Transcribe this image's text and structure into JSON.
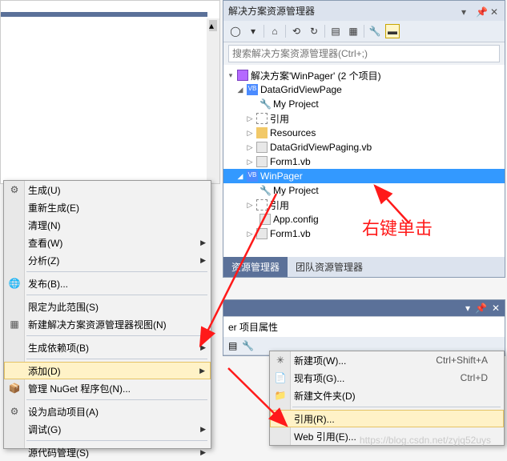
{
  "panel": {
    "title": "解决方案资源管理器",
    "search_placeholder": "搜索解决方案资源管理器(Ctrl+;)"
  },
  "tree": {
    "solution": "解决方案'WinPager' (2 个项目)",
    "proj1": "DataGridViewPage",
    "myproject": "My Project",
    "references": "引用",
    "resources": "Resources",
    "file1": "DataGridViewPaging.vb",
    "file2": "Form1.vb",
    "proj2": "WinPager",
    "p2_myproject": "My Project",
    "p2_references": "引用",
    "p2_appconfig": "App.config",
    "p2_form1": "Form1.vb"
  },
  "tabs": {
    "tab1": "资源管理器",
    "tab2": "团队资源管理器"
  },
  "props": {
    "title": "er 项目属性"
  },
  "ctx": {
    "build": "生成(U)",
    "rebuild": "重新生成(E)",
    "clean": "清理(N)",
    "view": "查看(W)",
    "analyze": "分析(Z)",
    "publish": "发布(B)...",
    "scope": "限定为此范围(S)",
    "newview": "新建解决方案资源管理器视图(N)",
    "builddeps": "生成依赖项(B)",
    "add": "添加(D)",
    "nuget": "管理 NuGet 程序包(N)...",
    "startup": "设为启动项目(A)",
    "debug": "调试(G)",
    "scm": "源代码管理(S)"
  },
  "sub": {
    "newitem": "新建项(W)...",
    "newitem_key": "Ctrl+Shift+A",
    "existing": "现有项(G)...",
    "existing_key": "Ctrl+D",
    "newfolder": "新建文件夹(D)",
    "reference": "引用(R)...",
    "webref": "Web 引用(E)..."
  },
  "annotation": "右键单击",
  "watermark": "https://blog.csdn.net/zyjq52uys"
}
